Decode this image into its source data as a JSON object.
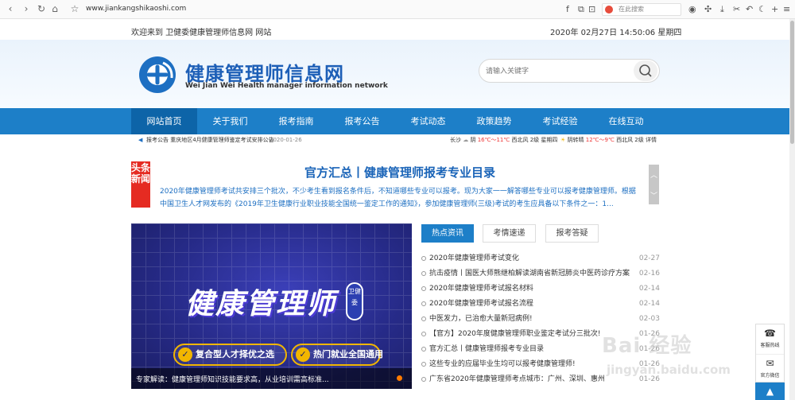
{
  "browser": {
    "url": "www.jiankangshikaoshi.com",
    "search_placeholder": "在此搜索"
  },
  "topbar": {
    "welcome": "欢迎来到 卫健委健康管理师信息网 网站",
    "datetime": "2020年 02月27日   14:50:06  星期四"
  },
  "header": {
    "logo_cn": "健康管理师信息网",
    "logo_en": "Wei Jian Wei Health manager information network",
    "search_placeholder": "请输入关键字"
  },
  "nav": [
    {
      "label": "网站首页",
      "active": true
    },
    {
      "label": "关于我们"
    },
    {
      "label": "报考指南"
    },
    {
      "label": "报考公告"
    },
    {
      "label": "考试动态"
    },
    {
      "label": "政策趋势"
    },
    {
      "label": "考试经验"
    },
    {
      "label": "在线互动"
    }
  ],
  "notice": {
    "text": "报考公告 重庆地区4月健康管理师鉴定考试安排公告",
    "date": "2020-01-26"
  },
  "weather": {
    "city": "长沙",
    "today": {
      "cond": "阴",
      "temp": "16℃～11℃",
      "wind": "西北风 2级",
      "day": "星期四"
    },
    "tomorrow": {
      "cond": "阴转晴",
      "temp": "12℃～9℃",
      "wind": "西北风 2级",
      "day": "详情"
    }
  },
  "headline": {
    "badge": "头条新闻",
    "title": "官方汇总丨健康管理师报考专业目录",
    "summary": "2020年健康管理师考试共安排三个批次，不少考生看到报名条件后，不知道哪些专业可以报考。现为大家一一解答哪些专业可以报考健康管理师。根据中国卫生人才网发布的《2019年卫生健康行业职业技能全国统一鉴定工作的通知》，参加健康管理师(三级)考试的考生应具备以下条件之一：1..."
  },
  "banner": {
    "title": "健康管理师",
    "badge": "卫健委",
    "pill_1": "复合型人才择优之选",
    "pill_2": "热门就业全国通用",
    "caption": "专家解读：健康管理师知识技能要求高，从业培训需高标准..."
  },
  "news": {
    "tabs": [
      "热点资讯",
      "考情速递",
      "报考答疑"
    ],
    "items": [
      {
        "title": "2020年健康管理师考试变化",
        "date": "02-27"
      },
      {
        "title": "抗击疫情丨国医大师熊继柏解读湖南省新冠肺炎中医药诊疗方案",
        "date": "02-16"
      },
      {
        "title": "2020年健康管理师考试报名材料",
        "date": "02-14"
      },
      {
        "title": "2020年健康管理师考试报名流程",
        "date": "02-14"
      },
      {
        "title": "中医发力，已治愈大量新冠病例!",
        "date": "02-03"
      },
      {
        "title": "【官方】2020年度健康管理师职业鉴定考试分三批次!",
        "date": "01-26"
      },
      {
        "title": "官方汇总丨健康管理师报考专业目录",
        "date": "01-26"
      },
      {
        "title": "这些专业的应届毕业生均可以报考健康管理师!",
        "date": "01-26"
      },
      {
        "title": "广东省2020年健康管理师考点城市：广州、深圳、惠州",
        "date": "01-26"
      }
    ]
  },
  "float": {
    "hotline": "客服热线",
    "wechat": "官方微信"
  },
  "watermark": {
    "brand": "Bai 经验",
    "sub": "jingyan.baidu.com"
  },
  "colors": {
    "brand_blue": "#1d7fc8",
    "badge_red": "#e52b22",
    "headline_blue": "#1a64b8"
  }
}
